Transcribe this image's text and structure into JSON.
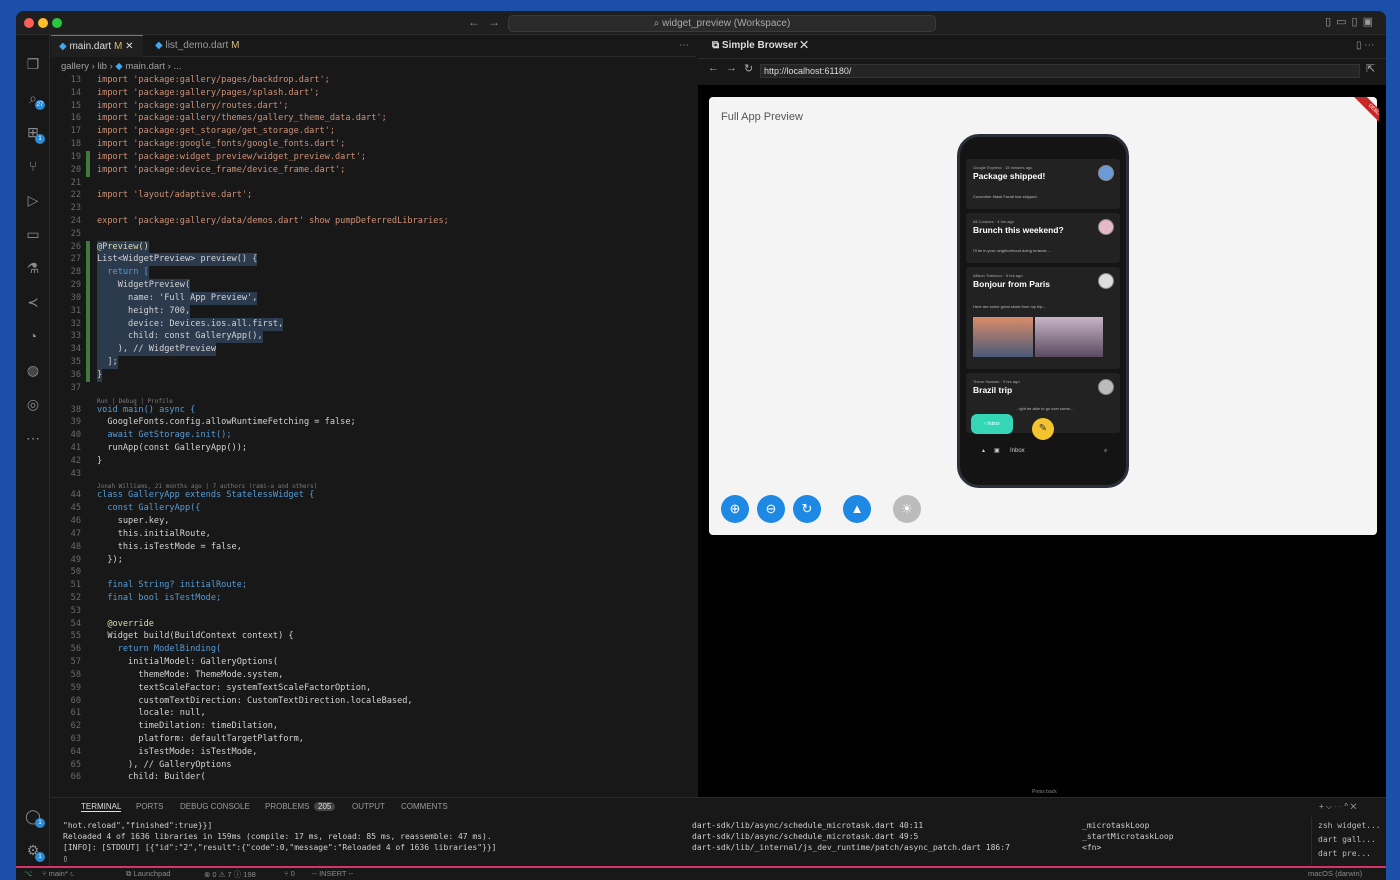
{
  "window": {
    "title": "widget_preview (Workspace)",
    "search_icon": "search-icon",
    "colors": {
      "accent": "#2a8ad4",
      "status_stripe": "#d6336c",
      "desktop": "#1c4fa8"
    }
  },
  "editor": {
    "tabs": [
      {
        "label": "main.dart",
        "status": "M",
        "active": true
      },
      {
        "label": "list_demo.dart",
        "status": "M",
        "active": false
      }
    ],
    "breadcrumb": [
      "gallery",
      "lib",
      "main.dart",
      "..."
    ],
    "codelens": {
      "blame_1": "Jonah Williams, 21 months ago | 7 authors (rami-a and others)",
      "run_debug": "Run | Debug | Profile"
    },
    "lines": [
      {
        "n": "13",
        "c": "import 'package:gallery/pages/backdrop.dart';"
      },
      {
        "n": "14",
        "c": "import 'package:gallery/pages/splash.dart';"
      },
      {
        "n": "15",
        "c": "import 'package:gallery/routes.dart';"
      },
      {
        "n": "16",
        "c": "import 'package:gallery/themes/gallery_theme_data.dart';"
      },
      {
        "n": "17",
        "c": "import 'package:get_storage/get_storage.dart';"
      },
      {
        "n": "18",
        "c": "import 'package:google_fonts/google_fonts.dart';"
      },
      {
        "n": "19",
        "c": "import 'package:widget_preview/widget_preview.dart';"
      },
      {
        "n": "20",
        "c": "import 'package:device_frame/device_frame.dart';"
      },
      {
        "n": "21",
        "c": ""
      },
      {
        "n": "22",
        "c": "import 'layout/adaptive.dart';"
      },
      {
        "n": "23",
        "c": ""
      },
      {
        "n": "24",
        "c": "export 'package:gallery/data/demos.dart' show pumpDeferredLibraries;"
      },
      {
        "n": "25",
        "c": ""
      },
      {
        "n": "26",
        "c": "@Preview()"
      },
      {
        "n": "27",
        "c": "List<WidgetPreview> preview() {"
      },
      {
        "n": "28",
        "c": "  return ["
      },
      {
        "n": "29",
        "c": "    WidgetPreview("
      },
      {
        "n": "30",
        "c": "      name: 'Full App Preview',"
      },
      {
        "n": "31",
        "c": "      height: 700,"
      },
      {
        "n": "32",
        "c": "      device: Devices.ios.all.first,"
      },
      {
        "n": "33",
        "c": "      child: const GalleryApp(),"
      },
      {
        "n": "34",
        "c": "    ), // WidgetPreview"
      },
      {
        "n": "35",
        "c": "  ];"
      },
      {
        "n": "36",
        "c": "}"
      },
      {
        "n": "37",
        "c": ""
      },
      {
        "n": "38",
        "c": "void main() async {"
      },
      {
        "n": "39",
        "c": "  GoogleFonts.config.allowRuntimeFetching = false;"
      },
      {
        "n": "40",
        "c": "  await GetStorage.init();"
      },
      {
        "n": "41",
        "c": "  runApp(const GalleryApp());"
      },
      {
        "n": "42",
        "c": "}"
      },
      {
        "n": "43",
        "c": ""
      },
      {
        "n": "44",
        "c": "class GalleryApp extends StatelessWidget {"
      },
      {
        "n": "45",
        "c": "  const GalleryApp({"
      },
      {
        "n": "46",
        "c": "    super.key,"
      },
      {
        "n": "47",
        "c": "    this.initialRoute,"
      },
      {
        "n": "48",
        "c": "    this.isTestMode = false,"
      },
      {
        "n": "49",
        "c": "  });"
      },
      {
        "n": "50",
        "c": ""
      },
      {
        "n": "51",
        "c": "  final String? initialRoute;"
      },
      {
        "n": "52",
        "c": "  final bool isTestMode;"
      },
      {
        "n": "53",
        "c": ""
      },
      {
        "n": "54",
        "c": "  @override"
      },
      {
        "n": "55",
        "c": "  Widget build(BuildContext context) {"
      },
      {
        "n": "56",
        "c": "    return ModelBinding("
      },
      {
        "n": "57",
        "c": "      initialModel: GalleryOptions("
      },
      {
        "n": "58",
        "c": "        themeMode: ThemeMode.system,"
      },
      {
        "n": "59",
        "c": "        textScaleFactor: systemTextScaleFactorOption,"
      },
      {
        "n": "60",
        "c": "        customTextDirection: CustomTextDirection.localeBased,"
      },
      {
        "n": "61",
        "c": "        locale: null,"
      },
      {
        "n": "62",
        "c": "        timeDilation: timeDilation,"
      },
      {
        "n": "63",
        "c": "        platform: defaultTargetPlatform,"
      },
      {
        "n": "64",
        "c": "        isTestMode: isTestMode,"
      },
      {
        "n": "65",
        "c": "      ), // GalleryOptions"
      },
      {
        "n": "66",
        "c": "      child: Builder("
      }
    ]
  },
  "browser": {
    "tab_label": "Simple Browser",
    "url": "http://localhost:61180/",
    "preview_title": "Full App Preview",
    "debug_banner": "DEBUG",
    "press_back": "Press back",
    "emails": [
      {
        "meta": "Google Express · 15 minutes ago",
        "subject": "Package shipped!",
        "snippet": "Cucumber Mask Facial has shipped."
      },
      {
        "meta": "Ali Connors · 4 hrs ago",
        "subject": "Brunch this weekend?",
        "snippet": "I'll be in your neighborhood doing errands ..."
      },
      {
        "meta": "Allison Trabucco · 5 hrs ago",
        "subject": "Bonjour from Paris",
        "snippet": "Here are some great shots from my trip..."
      },
      {
        "meta": "Trevor Hansen · 9 hrs ago",
        "subject": "Brazil trip",
        "snippet": "...ight be able to go over some..."
      }
    ],
    "fab_label": "Inbox",
    "bottom_label": "Inbox",
    "controls": [
      "zoom-in-icon",
      "zoom-out-icon",
      "reset-icon",
      "mountain-icon",
      "brightness-icon"
    ]
  },
  "panel": {
    "tabs": [
      "TERMINAL",
      "PORTS",
      "DEBUG CONSOLE",
      "PROBLEMS",
      "OUTPUT",
      "COMMENTS"
    ],
    "problems_count": "205",
    "terminal_left": [
      "\"hot.reload\",\"finished\":true}}]",
      "Reloaded 4 of 1636 libraries in 159ms (compile: 17 ms, reload: 85 ms, reassemble: 47 ms).",
      "[INFO]: [STDOUT] [{\"id\":\"2\",\"result\":{\"code\":0,\"message\":\"Reloaded 4 of 1636 libraries\"}}]"
    ],
    "terminal_mid": [
      "dart-sdk/lib/async/schedule_microtask.dart 40:11",
      "dart-sdk/lib/async/schedule_microtask.dart 49:5",
      "dart-sdk/lib/_internal/js_dev_runtime/patch/async_patch.dart 186:7"
    ],
    "terminal_right": [
      "_microtaskLoop",
      "_startMicrotaskLoop",
      "<fn>"
    ],
    "terminals": [
      "zsh widget...",
      "dart gall...",
      "dart pre..."
    ]
  },
  "status": {
    "branch": "main*",
    "launchpad": "Launchpad",
    "problems": "⊗ 0 ⚠ 7 ⓘ 198",
    "ports": "⑂ 0",
    "mode": "-- INSERT --",
    "os": "macOS (darwin)"
  }
}
